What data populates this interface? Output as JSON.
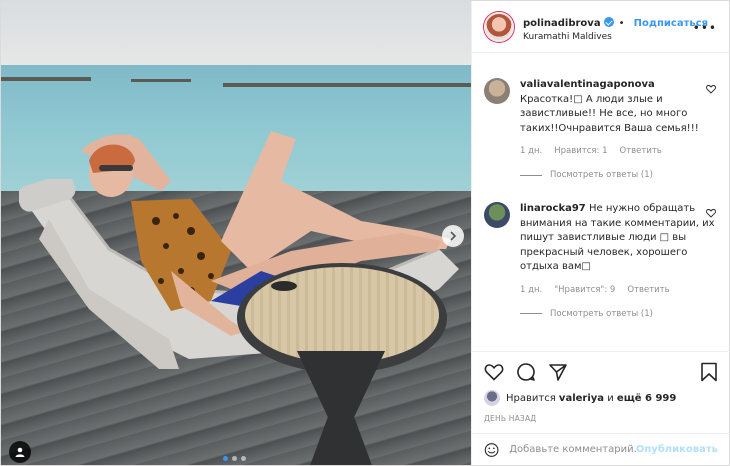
{
  "header": {
    "username": "polinadibrova",
    "follow_label": "Подписаться",
    "location": "Kuramathi Maldives",
    "more_icon": "ellipsis-icon"
  },
  "comments": [
    {
      "username": "valiavalentinagaponova",
      "text": "Красотка!□ А люди злые и завистливые!! Не все, но много таких!!Очнравится Ваша семья!!!",
      "time": "1 дн.",
      "likes": "Нравится: 1",
      "reply": "Ответить",
      "view_replies": "Посмотреть ответы (1)"
    },
    {
      "username": "linarocka97",
      "text": "Не нужно обращать внимания на такие комментарии, их пишут завистливые люди □ вы прекрасный человек, хорошего отдыха вам□",
      "time": "1 дн.",
      "likes": "\"Нравится\": 9",
      "reply": "Ответить",
      "view_replies": "Посмотреть ответы (1)"
    }
  ],
  "likes": {
    "prefix": "Нравится",
    "user": "valeriya",
    "and": "и",
    "others": "ещё 6 999"
  },
  "date": "ДЕНЬ НАЗАД",
  "add_comment": {
    "placeholder": "Добавьте комментарий...",
    "publish_label": "Опубликовать"
  },
  "colors": {
    "accent": "#3897f0",
    "muted": "#8e8e8e",
    "publish_disabled": "#b2dffc"
  }
}
